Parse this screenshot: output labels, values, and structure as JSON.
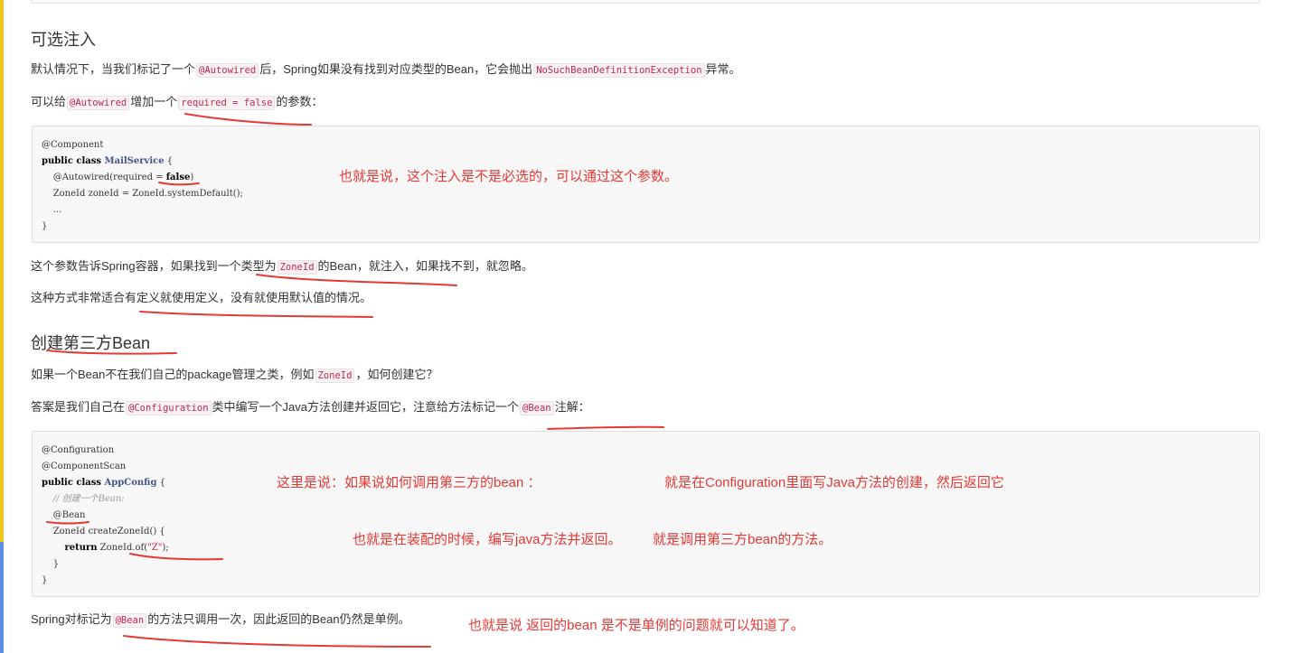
{
  "section1": {
    "title": "可选注入",
    "p1": {
      "a": "默认情况下，当我们标记了一个",
      "code1": "@Autowired",
      "b": "后，Spring如果没有找到对应类型的Bean，它会抛出",
      "code2": "NoSuchBeanDefinitionException",
      "c": "异常。"
    },
    "p2": {
      "a": "可以给",
      "code1": "@Autowired",
      "b": "增加一个",
      "code2": "required = false",
      "c": "的参数："
    },
    "code_block": {
      "lines": [
        "@Component",
        "public class MailService {",
        "    @Autowired(required = false)",
        "    ZoneId zoneId = ZoneId.systemDefault();",
        "    ...",
        "}"
      ],
      "tokens": {
        "l2_kw": "public class ",
        "l2_cls": "MailService",
        "l2_rest": " {",
        "l3_a": "    @Autowired(required = ",
        "l3_kw": "false",
        "l3_b": ")"
      }
    },
    "p3": {
      "a": "这个参数告诉Spring容器，如果找到一个类型为",
      "code1": "ZoneId",
      "b": "的Bean，就注入，如果找不到，就忽略。"
    },
    "p4": "这种方式非常适合有定义就使用定义，没有就使用默认值的情况。"
  },
  "section2": {
    "title": "创建第三方Bean",
    "p1": {
      "a": "如果一个Bean不在我们自己的package管理之类，例如",
      "code1": "ZoneId",
      "b": "，如何创建它？"
    },
    "p2": {
      "a": "答案是我们自己在",
      "code1": "@Configuration",
      "b": "类中编写一个Java方法创建并返回它，注意给方法标记一个",
      "code2": "@Bean",
      "c": "注解："
    },
    "code_block": {
      "lines": [
        "@Configuration",
        "@ComponentScan",
        "public class AppConfig {",
        "    // 创建一个Bean:",
        "    @Bean",
        "    ZoneId createZoneId() {",
        "        return ZoneId.of(\"Z\");",
        "    }",
        "}"
      ],
      "tokens": {
        "l3_kw": "public class ",
        "l3_cls": "AppConfig",
        "l3_rest": " {",
        "l7_indent": "        ",
        "l7_kw": "return",
        "l7_a": " ZoneId.of(",
        "l7_str": "\"Z\"",
        "l7_b": ");"
      }
    },
    "p3": {
      "a": "Spring对标记为",
      "code1": "@Bean",
      "b": "的方法只调用一次，因此返回的Bean仍然是单例。"
    }
  },
  "annotations": {
    "note1": "也就是说，这个注入是不是必选的，可以通过这个参数。",
    "note2": "这里是说：如果说如何调用第三方的bean  ：",
    "note3": "就是在Configuration里面写Java方法的创建，然后返回它",
    "note4": "也就是在装配的时候，编写java方法并返回。",
    "note5": "就是调用第三方bean的方法。",
    "note6": "也就是说  返回的bean 是不是单例的问题就可以知道了。"
  },
  "colors": {
    "annotation": "#e53935",
    "inline_code": "#c7254e",
    "accent_bar_top": "#f0c419",
    "accent_bar_bottom": "#5b8ee6"
  }
}
